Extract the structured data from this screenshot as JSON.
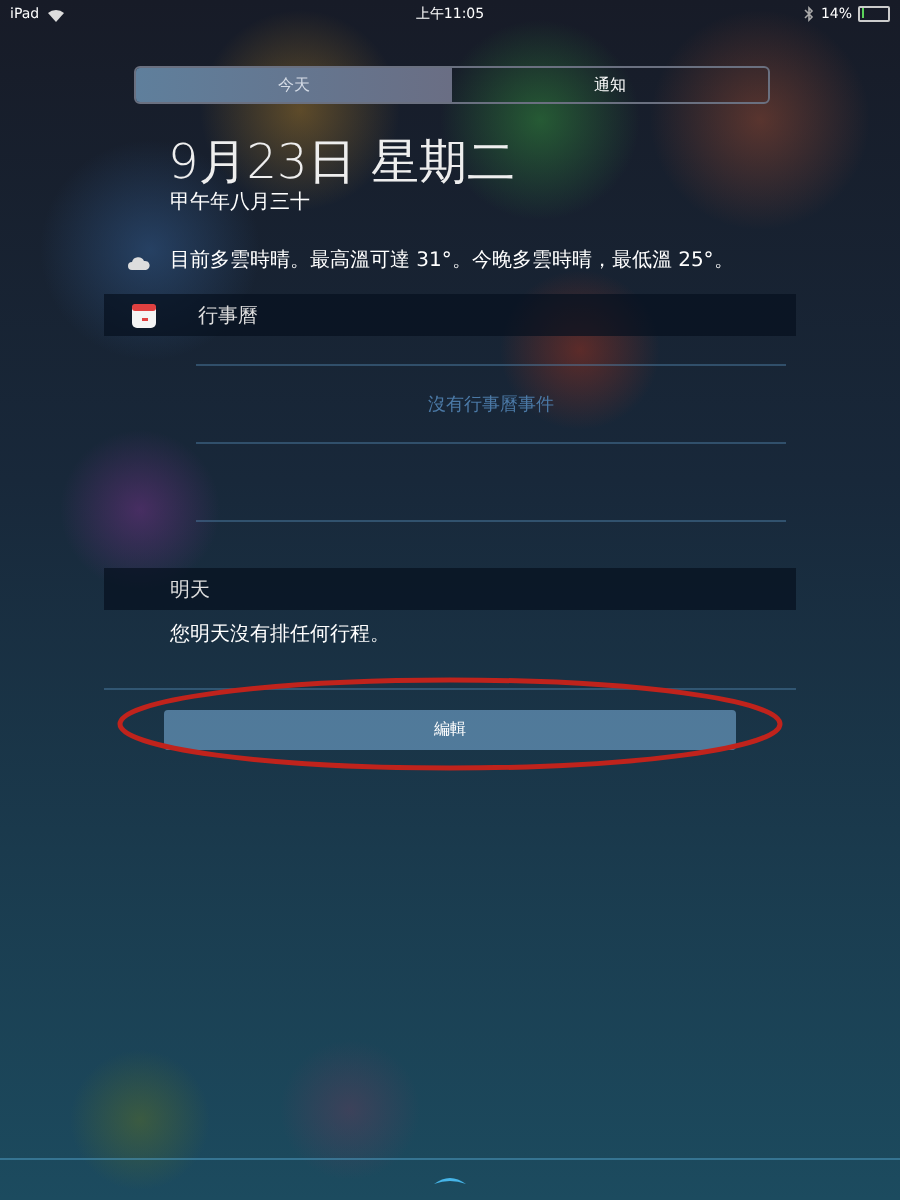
{
  "status_bar": {
    "device": "iPad",
    "time": "上午11:05",
    "battery": "14%"
  },
  "tabs": [
    {
      "label": "今天",
      "selected": true
    },
    {
      "label": "通知",
      "selected": false
    }
  ],
  "date": "9月23日 星期二",
  "lunar_date": "甲午年八月三十",
  "weather": "目前多雲時晴。最高溫可達 31°。今晚多雲時晴，最低溫 25°。",
  "calendar": {
    "title": "行事曆",
    "empty_text": "沒有行事曆事件"
  },
  "tomorrow": {
    "title": "明天",
    "text": "您明天沒有排任何行程。"
  },
  "edit_button": "編輯"
}
